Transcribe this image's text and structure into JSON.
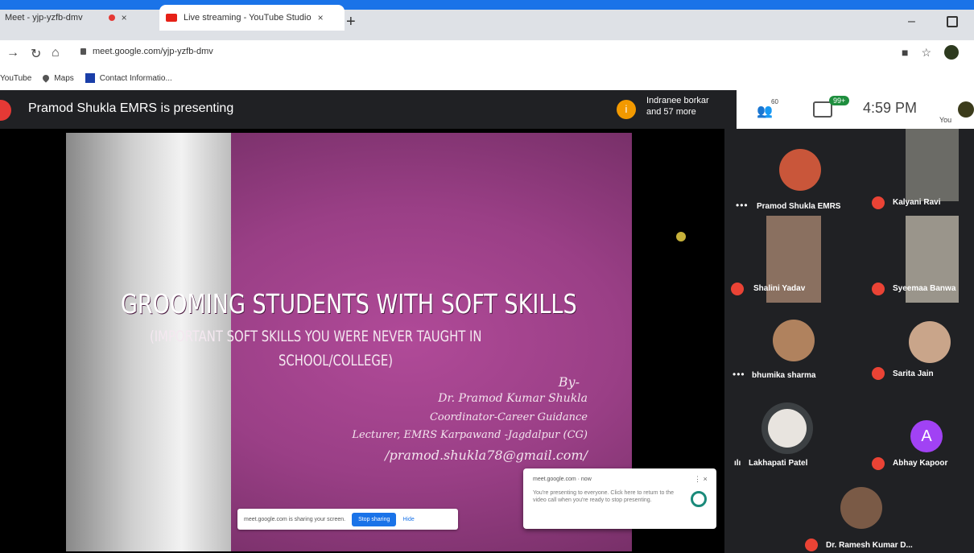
{
  "browser": {
    "tabs": [
      {
        "label": "Meet - yjp-yzfb-dmv",
        "active": false
      },
      {
        "label": "Live streaming - YouTube Studio",
        "active": true
      }
    ],
    "new_tab": "+",
    "url": "meet.google.com/yjp-yzfb-dmv",
    "bookmarks": [
      "YouTube",
      "Maps",
      "Contact Informatio..."
    ]
  },
  "meet": {
    "presenting": "Pramod Shukla EMRS is presenting",
    "joiners_line1": "Indranee borkar",
    "joiners_line2": "and 57 more",
    "joiner_initial": "i",
    "people_count": "60",
    "chat_badge": "99+",
    "time": "4:59 PM",
    "you_label": "You"
  },
  "slide": {
    "title": "GROOMING STUDENTS WITH SOFT SKILLS",
    "subtitle_line1": "(IMPORTANT SOFT SKILLS YOU WERE NEVER TAUGHT IN",
    "subtitle_line2": "SCHOOL/COLLEGE)",
    "by": "By-",
    "author": "Dr. Pramod Kumar Shukla",
    "role": "Coordinator-Career Guidance",
    "institution": "Lecturer, EMRS Karpawand -Jagdalpur (CG)",
    "email": "/pramod.shukla78@gmail.com/"
  },
  "sharing_bar": {
    "text": "meet.google.com is sharing your screen.",
    "stop_label": "Stop sharing",
    "hide_label": "Hide"
  },
  "notification": {
    "title": "meet.google.com · now",
    "body": "You're presenting to everyone. Click here to return to the video call when you're ready to stop presenting."
  },
  "participants": [
    {
      "name": "Pramod Shukla EMRS",
      "status": "more"
    },
    {
      "name": "Kalyani Ravi",
      "status": "muted"
    },
    {
      "name": "Shalini Yadav",
      "status": "muted"
    },
    {
      "name": "Syeemaa Banwa",
      "status": "muted"
    },
    {
      "name": "bhumika sharma",
      "status": "more"
    },
    {
      "name": "Sarita Jain",
      "status": "muted"
    },
    {
      "name": "Lakhapati Patel",
      "status": "speaking"
    },
    {
      "name": "Abhay Kapoor",
      "status": "muted",
      "initial": "A"
    },
    {
      "name": "Dr. Ramesh Kumar D...",
      "status": "muted"
    }
  ],
  "colors": {
    "chrome_blue": "#1a73e8",
    "meet_dark": "#202124",
    "mute_red": "#ea4335",
    "slide_pink": "#b04a98",
    "badge_green": "#1e8e3e"
  }
}
